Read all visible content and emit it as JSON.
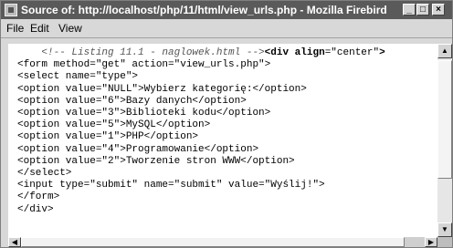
{
  "window": {
    "title": "Source of: http://localhost/php/11/html/view_urls.php - Mozilla Firebird"
  },
  "controls": {
    "minimize": "_",
    "maximize": "□",
    "close": "×"
  },
  "menu": {
    "items": [
      "File",
      "Edit",
      "View"
    ]
  },
  "source": {
    "comment": "<!-- Listing 11.1 - naglowek.html -->",
    "lines": [
      "<form method=\"get\" action=\"view_urls.php\">",
      "<select name=\"type\">",
      "<option value=\"NULL\">Wybierz kategorię:</option>",
      "<option value=\"6\">Bazy danych</option>",
      "<option value=\"3\">Biblioteki kodu</option>",
      "<option value=\"5\">MySQL</option>",
      "<option value=\"1\">PHP</option>",
      "<option value=\"4\">Programowanie</option>",
      "<option value=\"2\">Tworzenie stron WWW</option>",
      "</select>",
      "<input type=\"submit\" name=\"submit\" value=\"Wyślij!\">",
      "</form>",
      "</div>"
    ]
  },
  "scrollbars": {
    "up": "▲",
    "down": "▼",
    "left": "◀",
    "right": "▶"
  }
}
